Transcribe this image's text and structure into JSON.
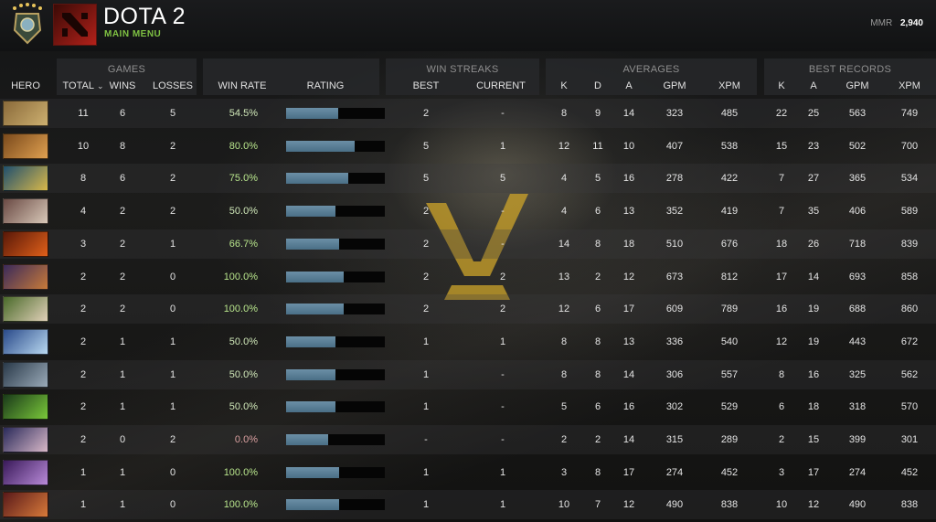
{
  "header": {
    "title": "DOTA 2",
    "subtitle": "MAIN MENU",
    "mmr_label": "MMR",
    "mmr_value": "2,940"
  },
  "groups": {
    "games": "GAMES",
    "win_streaks": "WIN STREAKS",
    "averages": "AVERAGES",
    "best_records": "BEST RECORDS"
  },
  "columns": {
    "hero": "HERO",
    "total": "TOTAL",
    "wins": "WINS",
    "losses": "LOSSES",
    "win_rate": "WIN RATE",
    "rating": "RATING",
    "best": "BEST",
    "current": "CURRENT",
    "avg_k": "K",
    "avg_d": "D",
    "avg_a": "A",
    "avg_gpm": "GPM",
    "avg_xpm": "XPM",
    "best_k": "K",
    "best_a": "A",
    "best_gpm": "GPM",
    "best_xpm": "XPM"
  },
  "colors": {
    "accent_green": "#7fc243",
    "rating_bar": "#5a7f96",
    "emblem_gold": "#c8a02a"
  },
  "rows": [
    {
      "portrait": "hero-portrait-1",
      "c1": "#8a6a3a",
      "c2": "#cdb070",
      "total": "11",
      "wins": "6",
      "losses": "5",
      "win_rate": "54.5%",
      "rating": 0.53,
      "best": "2",
      "current": "-",
      "k": "8",
      "d": "9",
      "a": "14",
      "gpm": "323",
      "xpm": "485",
      "bk": "22",
      "ba": "25",
      "bgpm": "563",
      "bxpm": "749"
    },
    {
      "portrait": "hero-portrait-2",
      "c1": "#7a4a1c",
      "c2": "#e0a050",
      "total": "10",
      "wins": "8",
      "losses": "2",
      "win_rate": "80.0%",
      "rating": 0.69,
      "best": "5",
      "current": "1",
      "k": "12",
      "d": "11",
      "a": "10",
      "gpm": "407",
      "xpm": "538",
      "bk": "15",
      "ba": "23",
      "bgpm": "502",
      "bxpm": "700"
    },
    {
      "portrait": "hero-portrait-3",
      "c1": "#1f4f6e",
      "c2": "#d8b84a",
      "total": "8",
      "wins": "6",
      "losses": "2",
      "win_rate": "75.0%",
      "rating": 0.63,
      "best": "5",
      "current": "5",
      "k": "4",
      "d": "5",
      "a": "16",
      "gpm": "278",
      "xpm": "422",
      "bk": "7",
      "ba": "27",
      "bgpm": "365",
      "bxpm": "534"
    },
    {
      "portrait": "hero-portrait-4",
      "c1": "#6a4a44",
      "c2": "#d8c8b8",
      "total": "4",
      "wins": "2",
      "losses": "2",
      "win_rate": "50.0%",
      "rating": 0.5,
      "best": "2",
      "current": "-",
      "k": "4",
      "d": "6",
      "a": "13",
      "gpm": "352",
      "xpm": "419",
      "bk": "7",
      "ba": "35",
      "bgpm": "406",
      "bxpm": "589"
    },
    {
      "portrait": "hero-portrait-5",
      "c1": "#5a1808",
      "c2": "#e0601a",
      "total": "3",
      "wins": "2",
      "losses": "1",
      "win_rate": "66.7%",
      "rating": 0.54,
      "best": "2",
      "current": "-",
      "k": "14",
      "d": "8",
      "a": "18",
      "gpm": "510",
      "xpm": "676",
      "bk": "18",
      "ba": "26",
      "bgpm": "718",
      "bxpm": "839"
    },
    {
      "portrait": "hero-portrait-6",
      "c1": "#3a2a5a",
      "c2": "#c87a3a",
      "total": "2",
      "wins": "2",
      "losses": "0",
      "win_rate": "100.0%",
      "rating": 0.58,
      "best": "2",
      "current": "2",
      "k": "13",
      "d": "2",
      "a": "12",
      "gpm": "673",
      "xpm": "812",
      "bk": "17",
      "ba": "14",
      "bgpm": "693",
      "bxpm": "858"
    },
    {
      "portrait": "hero-portrait-7",
      "c1": "#4a6a2a",
      "c2": "#e0d0b8",
      "total": "2",
      "wins": "2",
      "losses": "0",
      "win_rate": "100.0%",
      "rating": 0.58,
      "best": "2",
      "current": "2",
      "k": "12",
      "d": "6",
      "a": "17",
      "gpm": "609",
      "xpm": "789",
      "bk": "16",
      "ba": "19",
      "bgpm": "688",
      "bxpm": "860"
    },
    {
      "portrait": "hero-portrait-8",
      "c1": "#2a4a8a",
      "c2": "#b8d8f0",
      "total": "2",
      "wins": "1",
      "losses": "1",
      "win_rate": "50.0%",
      "rating": 0.5,
      "best": "1",
      "current": "1",
      "k": "8",
      "d": "8",
      "a": "13",
      "gpm": "336",
      "xpm": "540",
      "bk": "12",
      "ba": "19",
      "bgpm": "443",
      "bxpm": "672"
    },
    {
      "portrait": "hero-portrait-9",
      "c1": "#2a3a4a",
      "c2": "#9aaab8",
      "total": "2",
      "wins": "1",
      "losses": "1",
      "win_rate": "50.0%",
      "rating": 0.5,
      "best": "1",
      "current": "-",
      "k": "8",
      "d": "8",
      "a": "14",
      "gpm": "306",
      "xpm": "557",
      "bk": "8",
      "ba": "16",
      "bgpm": "325",
      "bxpm": "562"
    },
    {
      "portrait": "hero-portrait-10",
      "c1": "#1a3a1a",
      "c2": "#7ac83a",
      "total": "2",
      "wins": "1",
      "losses": "1",
      "win_rate": "50.0%",
      "rating": 0.5,
      "best": "1",
      "current": "-",
      "k": "5",
      "d": "6",
      "a": "16",
      "gpm": "302",
      "xpm": "529",
      "bk": "6",
      "ba": "18",
      "bgpm": "318",
      "bxpm": "570"
    },
    {
      "portrait": "hero-portrait-11",
      "c1": "#2a2a5a",
      "c2": "#d8b8c8",
      "total": "2",
      "wins": "0",
      "losses": "2",
      "win_rate": "0.0%",
      "rating": 0.43,
      "best": "-",
      "current": "-",
      "k": "2",
      "d": "2",
      "a": "14",
      "gpm": "315",
      "xpm": "289",
      "bk": "2",
      "ba": "15",
      "bgpm": "399",
      "bxpm": "301"
    },
    {
      "portrait": "hero-portrait-12",
      "c1": "#3a1a5a",
      "c2": "#b88ad8",
      "total": "1",
      "wins": "1",
      "losses": "0",
      "win_rate": "100.0%",
      "rating": 0.54,
      "best": "1",
      "current": "1",
      "k": "3",
      "d": "8",
      "a": "17",
      "gpm": "274",
      "xpm": "452",
      "bk": "3",
      "ba": "17",
      "bgpm": "274",
      "bxpm": "452"
    },
    {
      "portrait": "hero-portrait-13",
      "c1": "#5a1a1a",
      "c2": "#d87a3a",
      "total": "1",
      "wins": "1",
      "losses": "0",
      "win_rate": "100.0%",
      "rating": 0.54,
      "best": "1",
      "current": "1",
      "k": "10",
      "d": "7",
      "a": "12",
      "gpm": "490",
      "xpm": "838",
      "bk": "10",
      "ba": "12",
      "bgpm": "490",
      "bxpm": "838"
    }
  ]
}
